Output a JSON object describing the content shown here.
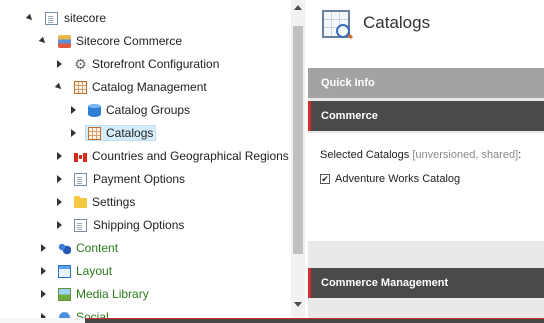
{
  "tree": {
    "nodes": [
      {
        "label": "sitecore",
        "icon": "document-icon",
        "expanded": true,
        "color": "default"
      },
      {
        "label": "Sitecore Commerce",
        "icon": "commerce-icon",
        "expanded": true,
        "color": "default"
      },
      {
        "label": "Storefront Configuration",
        "icon": "gear-icon",
        "expanded": false,
        "color": "default"
      },
      {
        "label": "Catalog Management",
        "icon": "grid-icon",
        "expanded": true,
        "color": "default"
      },
      {
        "label": "Catalog Groups",
        "icon": "database-icon",
        "expanded": false,
        "color": "default"
      },
      {
        "label": "Catalogs",
        "icon": "catalog-grid-icon",
        "expanded": false,
        "selected": true,
        "color": "default"
      },
      {
        "label": "Countries and Geographical Regions",
        "icon": "flag-icon",
        "expanded": false,
        "color": "default"
      },
      {
        "label": "Payment Options",
        "icon": "document-icon",
        "expanded": false,
        "color": "default"
      },
      {
        "label": "Settings",
        "icon": "folder-icon",
        "expanded": false,
        "color": "default"
      },
      {
        "label": "Shipping Options",
        "icon": "document-icon",
        "expanded": false,
        "color": "default"
      },
      {
        "label": "Content",
        "icon": "content-icon",
        "expanded": false,
        "color": "#2c7a1c"
      },
      {
        "label": "Layout",
        "icon": "layout-icon",
        "expanded": false,
        "color": "#2c7a1c"
      },
      {
        "label": "Media Library",
        "icon": "media-icon",
        "expanded": false,
        "color": "#2c7a1c"
      },
      {
        "label": "Social",
        "icon": "social-icon",
        "expanded": false,
        "color": "#2c7a1c"
      }
    ]
  },
  "editor": {
    "title": "Catalogs",
    "icon": "catalog-search-icon",
    "sections": {
      "quick_info": "Quick Info",
      "commerce": "Commerce",
      "commerce_management": "Commerce Management"
    },
    "field": {
      "label": "Selected Catalogs",
      "meta": "[unversioned, shared]",
      "suffix": ":",
      "options": [
        {
          "label": "Adventure Works Catalog",
          "checked": true
        }
      ]
    }
  },
  "colors": {
    "accent_red": "#d32f2f",
    "section_dark": "#4a4a4a",
    "section_light": "#a3a3a3",
    "selection": "#d4ecfb",
    "green_label": "#2c7a1c"
  }
}
